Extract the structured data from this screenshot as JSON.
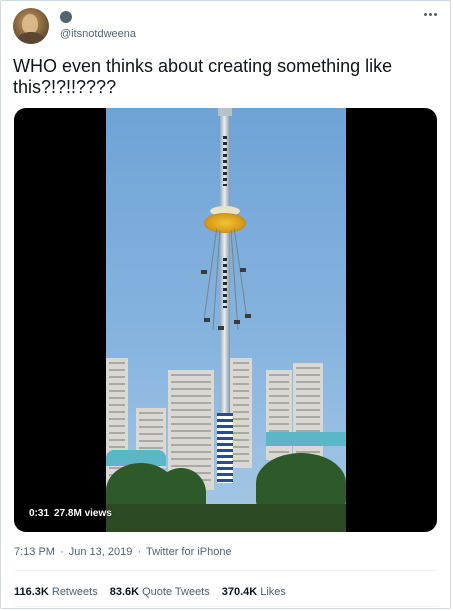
{
  "author": {
    "handle": "@itsnotdweena"
  },
  "tweet": {
    "text": "WHO even thinks about creating something like\nthis?!?!!????"
  },
  "video": {
    "time": "0:31",
    "views_count": "27.8M",
    "views_label": "views"
  },
  "meta": {
    "time": "7:13 PM",
    "separator": "·",
    "date": "Jun 13, 2019",
    "source": "Twitter for iPhone"
  },
  "stats": {
    "retweets_count": "116.3K",
    "retweets_label": "Retweets",
    "quotes_count": "83.6K",
    "quotes_label": "Quote Tweets",
    "likes_count": "370.4K",
    "likes_label": "Likes"
  }
}
